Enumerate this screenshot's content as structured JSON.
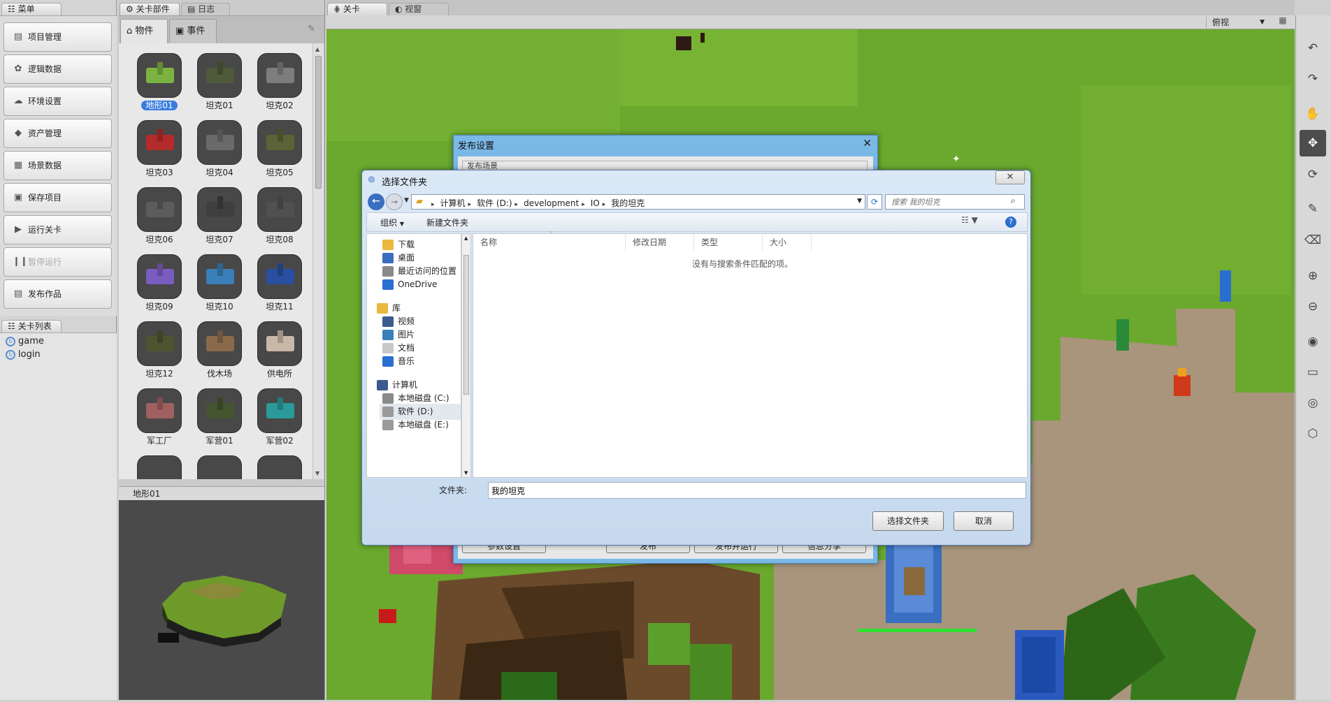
{
  "left_panel": {
    "tab_menu": "菜单",
    "menu": [
      {
        "label": "项目管理",
        "icon": "list-icon"
      },
      {
        "label": "逻辑数据",
        "icon": "gear-icon"
      },
      {
        "label": "环境设置",
        "icon": "cloud-icon"
      },
      {
        "label": "资产管理",
        "icon": "box-icon"
      },
      {
        "label": "场景数据",
        "icon": "grid-icon"
      },
      {
        "label": "保存项目",
        "icon": "save-icon"
      },
      {
        "label": "运行关卡",
        "icon": "play-icon"
      },
      {
        "label": "暂停运行",
        "icon": "pause-icon",
        "disabled": true
      },
      {
        "label": "发布作品",
        "icon": "publish-icon"
      }
    ],
    "tab_levels": "关卡列表",
    "levels": [
      "game",
      "login"
    ]
  },
  "asset_panel": {
    "tab_parts": "关卡部件",
    "tab_log": "日志",
    "subtab_objects": "物件",
    "subtab_events": "事件",
    "items": [
      {
        "label": "地形01",
        "selected": true,
        "color": "#7bb341"
      },
      {
        "label": "坦克01",
        "color": "#4e5a3a"
      },
      {
        "label": "坦克02",
        "color": "#7d7d7d"
      },
      {
        "label": "坦克03",
        "color": "#b52a2a"
      },
      {
        "label": "坦克04",
        "color": "#6a6a6a"
      },
      {
        "label": "坦克05",
        "color": "#5b6236"
      },
      {
        "label": "坦克06",
        "color": "#5c5c5c"
      },
      {
        "label": "坦克07",
        "color": "#3f3f3f"
      },
      {
        "label": "坦克08",
        "color": "#505050"
      },
      {
        "label": "坦克09",
        "color": "#7a5cc0"
      },
      {
        "label": "坦克10",
        "color": "#3a7fb8"
      },
      {
        "label": "坦克11",
        "color": "#2a4fa0"
      },
      {
        "label": "坦克12",
        "color": "#4f5430"
      },
      {
        "label": "伐木场",
        "color": "#8a6a4a"
      },
      {
        "label": "供电所",
        "color": "#c8b8a8"
      },
      {
        "label": "军工厂",
        "color": "#a06060"
      },
      {
        "label": "军营01",
        "color": "#445530"
      },
      {
        "label": "军营02",
        "color": "#2a9a9a"
      }
    ],
    "preview_label": "地形01"
  },
  "viewport": {
    "tab_level": "关卡",
    "tab_view": "视窗",
    "view_mode": "俯视"
  },
  "publish_dialog": {
    "title": "发布设置",
    "section": "发布场景",
    "buttons": [
      "参数设置",
      "发布",
      "发布并运行",
      "信息分享"
    ]
  },
  "folder_dialog": {
    "title": "选择文件夹",
    "breadcrumb": [
      "计算机",
      "软件 (D:)",
      "development",
      "IO",
      "我的坦克"
    ],
    "search_placeholder": "搜索 我的坦克",
    "organize": "组织",
    "new_folder": "新建文件夹",
    "nav": [
      {
        "label": "下载",
        "group": "fav",
        "color": "#e8b840"
      },
      {
        "label": "桌面",
        "group": "fav",
        "color": "#3a6fc0"
      },
      {
        "label": "最近访问的位置",
        "group": "fav",
        "color": "#8a8a8a"
      },
      {
        "label": "OneDrive",
        "group": "fav",
        "color": "#2a6fd0"
      },
      {
        "label": "库",
        "group": "lib",
        "color": "#e8b840"
      },
      {
        "label": "视频",
        "group": "lib",
        "color": "#3a5a90"
      },
      {
        "label": "图片",
        "group": "lib",
        "color": "#3a7fb8"
      },
      {
        "label": "文档",
        "group": "lib",
        "color": "#c8c8c8"
      },
      {
        "label": "音乐",
        "group": "lib",
        "color": "#2a6fd0"
      },
      {
        "label": "计算机",
        "group": "pc",
        "color": "#3a5a90"
      },
      {
        "label": "本地磁盘 (C:)",
        "group": "pc",
        "color": "#8a8a8a"
      },
      {
        "label": "软件 (D:)",
        "group": "pc",
        "color": "#9a9a9a",
        "selected": true
      },
      {
        "label": "本地磁盘 (E:)",
        "group": "pc",
        "color": "#9a9a9a"
      }
    ],
    "columns": [
      "名称",
      "修改日期",
      "类型",
      "大小"
    ],
    "empty_message": "没有与搜索条件匹配的项。",
    "folder_label": "文件夹:",
    "folder_value": "我的坦克",
    "ok": "选择文件夹",
    "cancel": "取消"
  },
  "colors": {
    "grass": "#6aa82e",
    "dirt": "#a8957c",
    "dialog_title": "#7ab8e6",
    "selection": "#3a7de0"
  }
}
